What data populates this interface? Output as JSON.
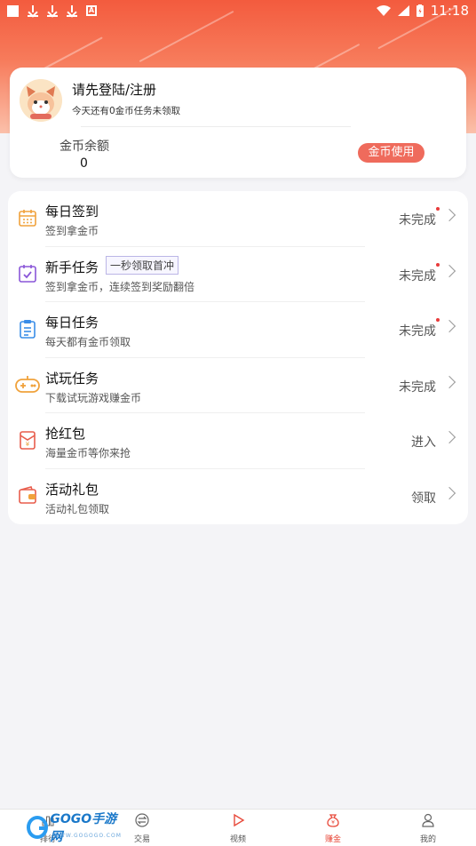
{
  "status_bar": {
    "time": "11:18"
  },
  "user_card": {
    "login_title": "请先登陆/注册",
    "subtitle": "今天还有0金币任务未领取",
    "coin_label": "金币余额",
    "coin_value": "0",
    "coin_use_button": "金币使用"
  },
  "tasks": [
    {
      "title": "每日签到",
      "desc": "签到拿金币",
      "status": "未完成",
      "has_dot": true,
      "icon": "calendar-icon"
    },
    {
      "title": "新手任务",
      "tag": "一秒领取首冲",
      "desc": "签到拿金币，连续签到奖励翻倍",
      "status": "未完成",
      "has_dot": true,
      "icon": "checkbox-icon"
    },
    {
      "title": "每日任务",
      "desc": "每天都有金币领取",
      "status": "未完成",
      "has_dot": true,
      "icon": "clipboard-icon"
    },
    {
      "title": "试玩任务",
      "desc": "下载试玩游戏赚金币",
      "status": "未完成",
      "has_dot": false,
      "icon": "gamepad-icon"
    },
    {
      "title": "抢红包",
      "desc": "海量金币等你来抢",
      "status": "进入",
      "has_dot": false,
      "icon": "red-envelope-icon"
    },
    {
      "title": "活动礼包",
      "desc": "活动礼包领取",
      "status": "领取",
      "has_dot": false,
      "icon": "wallet-icon"
    }
  ],
  "bottom_nav": [
    {
      "label": "排行",
      "icon": "ranking-icon"
    },
    {
      "label": "交易",
      "icon": "exchange-icon"
    },
    {
      "label": "视频",
      "icon": "video-icon"
    },
    {
      "label": "赚金",
      "icon": "coin-bag-icon",
      "active": true
    },
    {
      "label": "我的",
      "icon": "user-icon"
    }
  ],
  "watermark": {
    "brand": "GOGO手游网",
    "url": "WWW.GOGOGO.COM"
  },
  "colors": {
    "accent": "#ef6b5c",
    "header": "#f35b3e",
    "dot": "#e83b3b",
    "active_nav": "#e84a3b"
  }
}
